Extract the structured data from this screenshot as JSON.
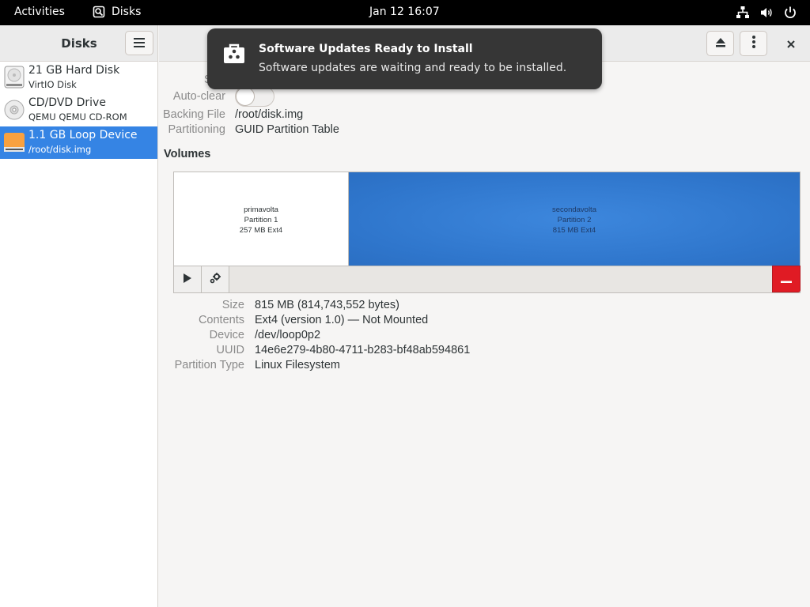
{
  "topbar": {
    "activities": "Activities",
    "app_name": "Disks",
    "clock": "Jan 12  16:07",
    "tray_icons": [
      "network-icon",
      "volume-icon",
      "power-icon"
    ]
  },
  "sidebar": {
    "title": "Disks",
    "items": [
      {
        "name": "21 GB Hard Disk",
        "sub": "VirtIO Disk",
        "icon": "hard-disk-icon",
        "selected": false
      },
      {
        "name": "CD/DVD Drive",
        "sub": "QEMU QEMU CD-ROM",
        "icon": "optical-disc-icon",
        "selected": false
      },
      {
        "name": "1.1 GB Loop Device",
        "sub": "/root/disk.img",
        "icon": "loop-device-icon",
        "selected": true
      }
    ]
  },
  "notification": {
    "title": "Software Updates Ready to Install",
    "body": "Software updates are waiting and ready to be installed.",
    "icon": "software-update-icon"
  },
  "disk_props": {
    "partial_label": "S",
    "auto_clear_label": "Auto-clear",
    "auto_clear_on": false,
    "backing_file_label": "Backing File",
    "backing_file": "/root/disk.img",
    "partitioning_label": "Partitioning",
    "partitioning": "GUID Partition Table"
  },
  "volumes": {
    "heading": "Volumes",
    "partitions": [
      {
        "name": "primavolta",
        "number": "Partition 1",
        "info": "257 MB Ext4",
        "selected": false
      },
      {
        "name": "secondavolta",
        "number": "Partition 2",
        "info": "815 MB Ext4",
        "selected": true
      }
    ]
  },
  "partition_props": {
    "size_label": "Size",
    "size": "815 MB (814,743,552 bytes)",
    "contents_label": "Contents",
    "contents": "Ext4 (version 1.0) — Not Mounted",
    "device_label": "Device",
    "device": "/dev/loop0p2",
    "uuid_label": "UUID",
    "uuid": "14e6e279-4b80-4711-b283-bf48ab594861",
    "type_label": "Partition Type",
    "type": "Linux Filesystem"
  },
  "colors": {
    "accent": "#3584e4",
    "destructive": "#e01b24",
    "notification_bg": "#363636"
  }
}
